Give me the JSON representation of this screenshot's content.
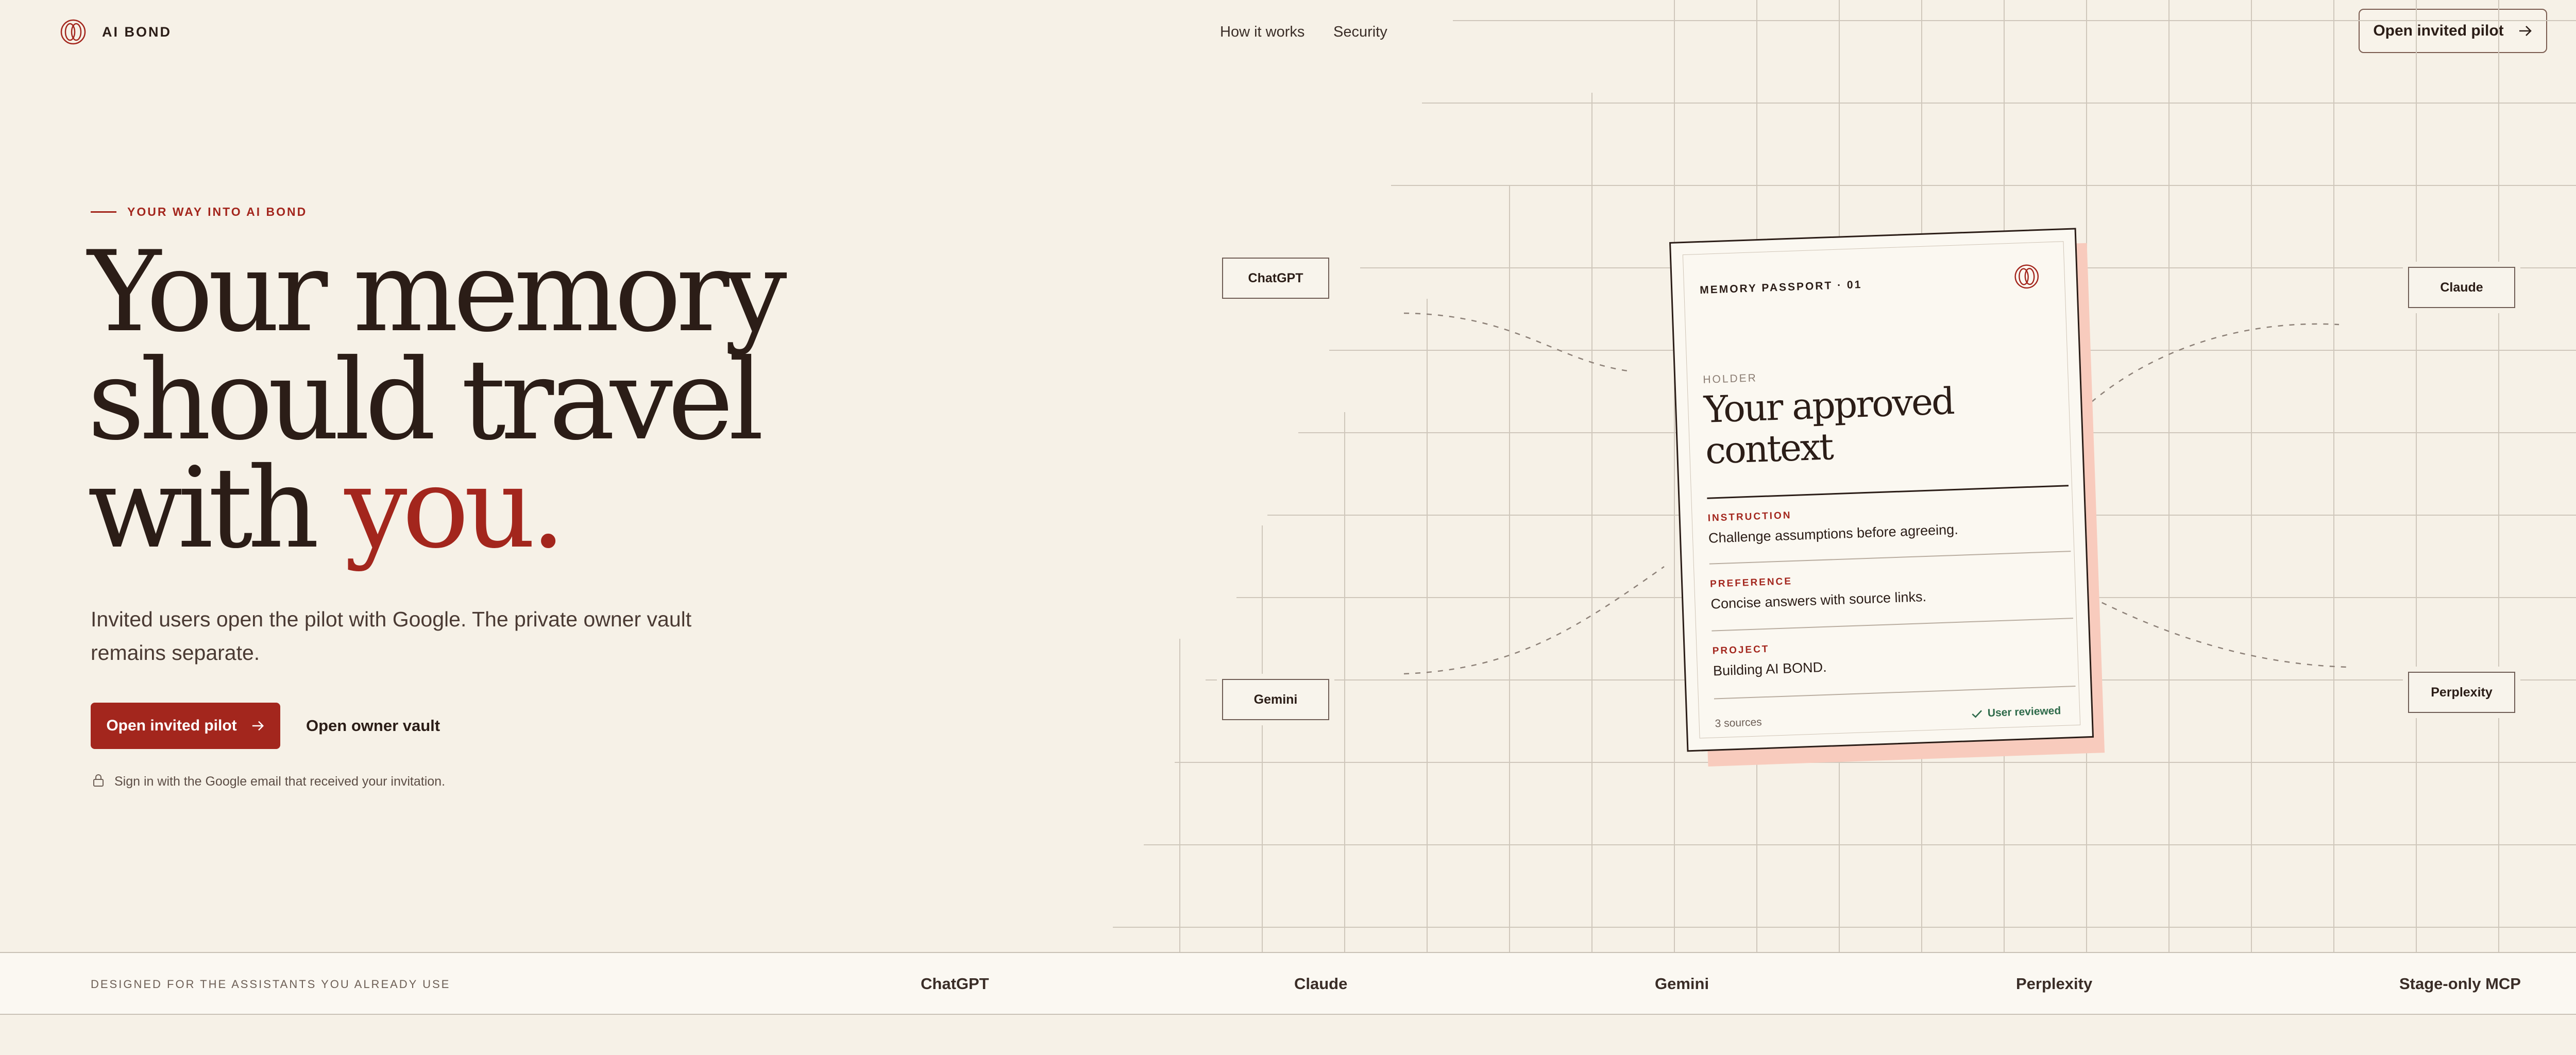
{
  "nav": {
    "brand": "AI BOND",
    "links": [
      "How it works",
      "Security"
    ],
    "cta_label": "Open invited pilot"
  },
  "hero": {
    "eyebrow": "YOUR WAY INTO AI BOND",
    "headline_line1": "Your memory",
    "headline_line2": "should travel",
    "headline_line3_a": "with ",
    "headline_line3_b": "you.",
    "subtitle": "Invited users open the pilot with Google. The private owner vault remains separate.",
    "primary_button": "Open invited pilot",
    "secondary_button": "Open owner vault",
    "signin_note": "Sign in with the Google email that received your invitation."
  },
  "diagram": {
    "assistants": {
      "top_left": "ChatGPT",
      "bottom_left": "Gemini",
      "top_right": "Claude",
      "bottom_right": "Perplexity"
    },
    "card": {
      "title": "MEMORY PASSPORT · 01",
      "holder_label": "HOLDER",
      "holder_value": "Your approved context",
      "fields": [
        {
          "label": "INSTRUCTION",
          "value": "Challenge assumptions before agreeing."
        },
        {
          "label": "PREFERENCE",
          "value": "Concise answers with source links."
        },
        {
          "label": "PROJECT",
          "value": "Building AI BOND."
        }
      ],
      "sources": "3 sources",
      "reviewed": "User reviewed"
    }
  },
  "strip": {
    "label": "DESIGNED FOR THE ASSISTANTS YOU ALREADY USE",
    "items": [
      "ChatGPT",
      "Claude",
      "Gemini",
      "Perplexity",
      "Stage-only MCP"
    ]
  },
  "colors": {
    "background": "#f6f1e7",
    "accent": "#a3261d",
    "ink": "#2b1d17",
    "card_shadow": "#f8cbbd",
    "verified": "#2e6a4a"
  },
  "icons": [
    "logo-icon",
    "arrow-right-icon",
    "lock-icon",
    "check-icon"
  ]
}
